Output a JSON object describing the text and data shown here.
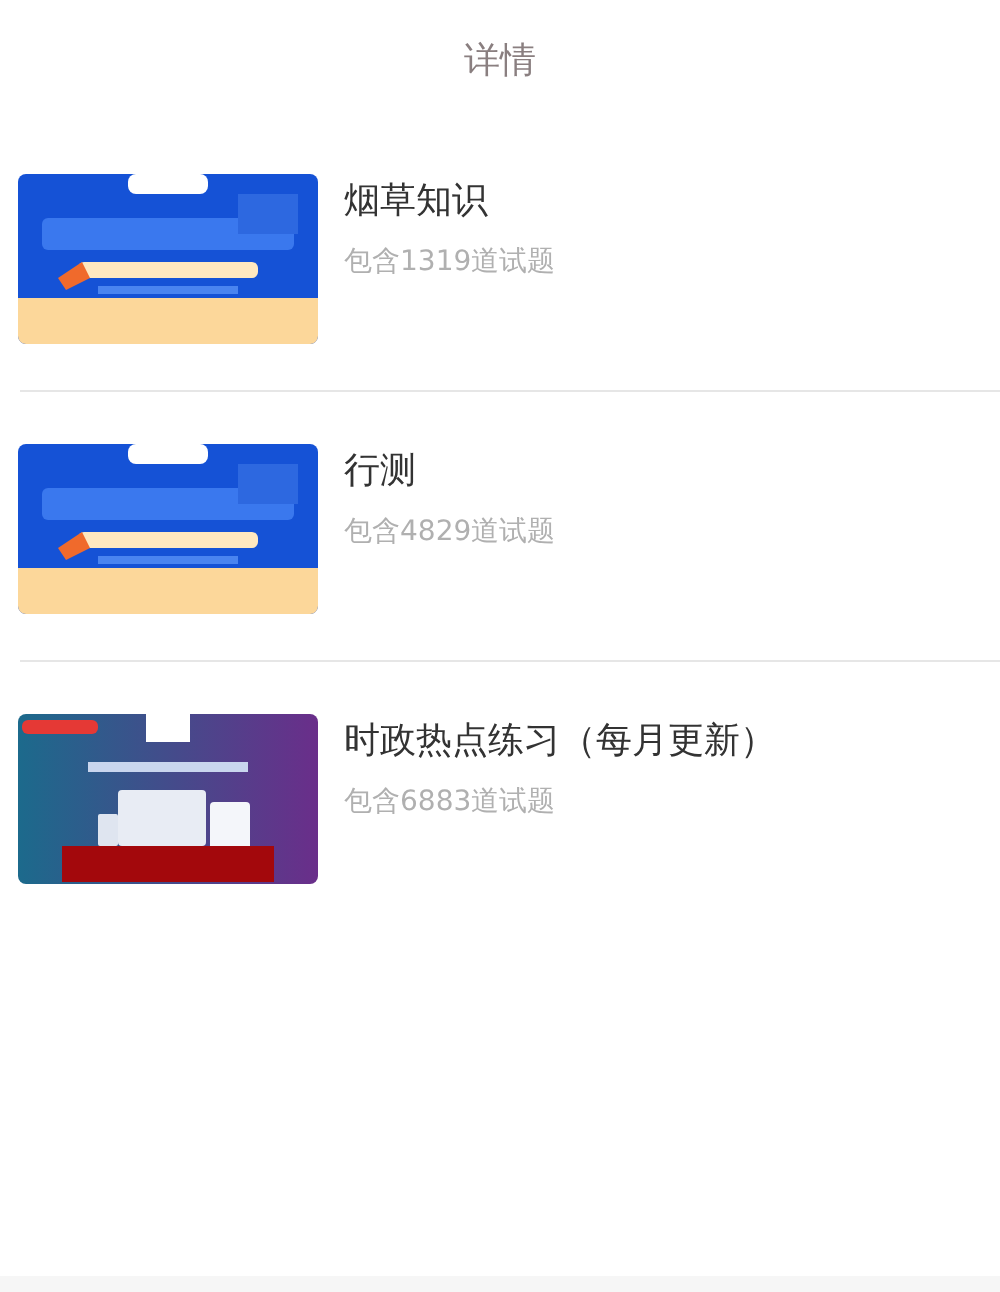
{
  "header": {
    "title": "详情"
  },
  "items": [
    {
      "title": "烟草知识",
      "count": "包含1319道试题",
      "thumb": {
        "kind": "bluebanner"
      }
    },
    {
      "title": "行测",
      "count": "包含4829道试题",
      "thumb": {
        "kind": "bluebanner"
      }
    },
    {
      "title": "时政热点练习（每月更新）",
      "count": "包含6883道试题",
      "thumb": {
        "kind": "purplebanner"
      }
    }
  ]
}
